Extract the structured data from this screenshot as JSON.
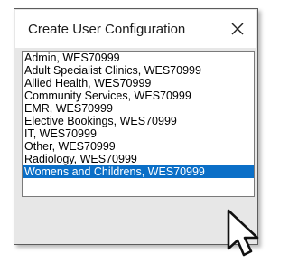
{
  "dialog": {
    "title": "Create User Configuration",
    "close_icon": "close-icon"
  },
  "list": {
    "selected_index": 9,
    "items": [
      "Admin, WES70999",
      "Adult Specialist Clinics, WES70999",
      "Allied Health, WES70999",
      "Community Services, WES70999",
      "EMR, WES70999",
      "Elective Bookings, WES70999",
      "IT, WES70999",
      "Other, WES70999",
      "Radiology, WES70999",
      "Womens and Childrens, WES70999"
    ]
  },
  "colors": {
    "selection": "#0b6fc7",
    "border": "#5c5c5c",
    "dialog_body": "#e7e7e7"
  },
  "cursor_icon": "arrow-pointer-icon"
}
